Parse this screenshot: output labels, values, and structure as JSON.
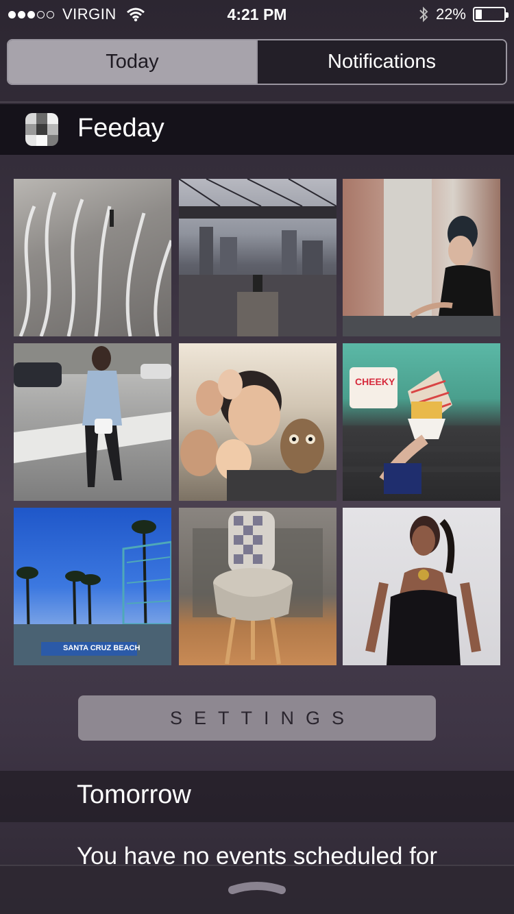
{
  "status_bar": {
    "carrier": "VIRGIN",
    "signal_dots_filled": 3,
    "signal_dots_total": 5,
    "time": "4:21 PM",
    "battery_text": "22%",
    "battery_level": 0.22
  },
  "segments": {
    "today": "Today",
    "notifications": "Notifications",
    "selected": "today"
  },
  "widget": {
    "title": "Feeday",
    "icon": "feeday-checker-icon"
  },
  "photos": [
    {
      "label": "photo-plaza-stripes"
    },
    {
      "label": "photo-brooklyn-bridge"
    },
    {
      "label": "photo-woman-brick-wall"
    },
    {
      "label": "photo-fashion-street"
    },
    {
      "label": "photo-group-selfie-owl"
    },
    {
      "label": "photo-cheeky-fries",
      "caption": "CHEEKY"
    },
    {
      "label": "photo-santa-cruz-beach",
      "caption": "SANTA CRUZ BEACH"
    },
    {
      "label": "photo-letter-d-stool"
    },
    {
      "label": "photo-woman-black-corset"
    }
  ],
  "settings_label": "SETTINGS",
  "tomorrow": {
    "title": "Tomorrow",
    "events_text": "You have no events scheduled for"
  },
  "colors": {
    "segment_active_bg": "#a7a3ab",
    "widget_header_bg": "#15121a",
    "settings_bg": "#8e8891"
  }
}
